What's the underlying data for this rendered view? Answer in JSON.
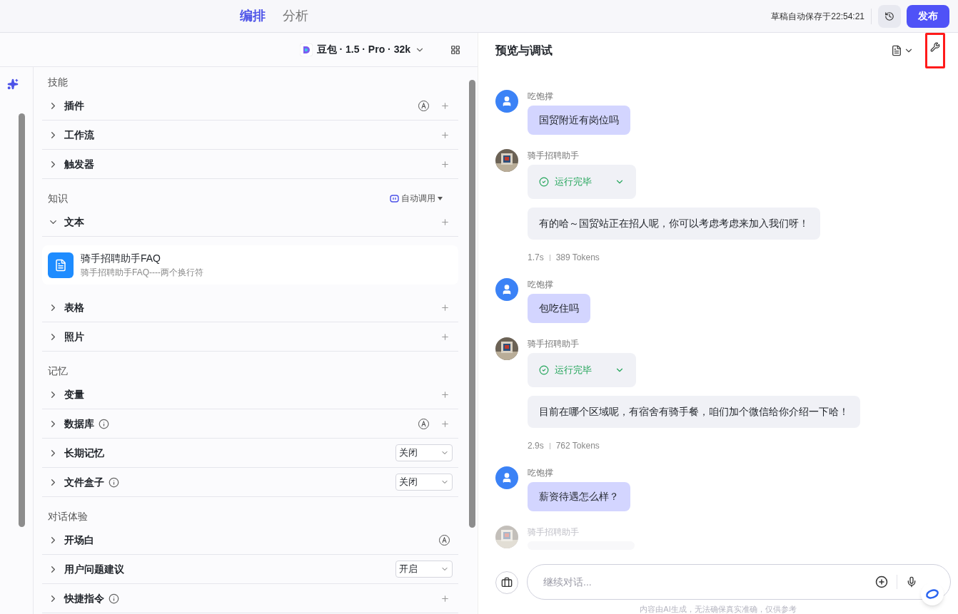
{
  "tabs": [
    {
      "label": "编排",
      "selected": true
    },
    {
      "label": "分析",
      "selected": false
    }
  ],
  "header": {
    "autosave": "草稿自动保存于22:54:21",
    "publish": "发布"
  },
  "model": {
    "name": "豆包 · 1.5 · Pro · 32k"
  },
  "sections": [
    {
      "title": "技能",
      "items": [
        {
          "label": "插件",
          "expanded": false,
          "info": false,
          "auto": true,
          "kind": "add"
        },
        {
          "label": "工作流",
          "expanded": false,
          "info": false,
          "auto": false,
          "kind": "add"
        },
        {
          "label": "触发器",
          "expanded": false,
          "info": false,
          "auto": false,
          "kind": "add"
        }
      ]
    },
    {
      "title": "知识",
      "mode": "自动调用",
      "items": [
        {
          "label": "文本",
          "expanded": true,
          "info": false,
          "auto": false,
          "kind": "add",
          "children": [
            {
              "title": "骑手招聘助手FAQ",
              "subtitle": "骑手招聘助手FAQ----两个换行符"
            }
          ]
        },
        {
          "label": "表格",
          "expanded": false,
          "info": false,
          "auto": false,
          "kind": "add"
        },
        {
          "label": "照片",
          "expanded": false,
          "info": false,
          "auto": false,
          "kind": "add"
        }
      ]
    },
    {
      "title": "记忆",
      "items": [
        {
          "label": "变量",
          "expanded": false,
          "info": false,
          "auto": false,
          "kind": "add"
        },
        {
          "label": "数据库",
          "expanded": false,
          "info": true,
          "auto": true,
          "kind": "add"
        },
        {
          "label": "长期记忆",
          "expanded": false,
          "info": false,
          "auto": false,
          "kind": "select",
          "value": "关闭"
        },
        {
          "label": "文件盒子",
          "expanded": false,
          "info": true,
          "auto": false,
          "kind": "select",
          "value": "关闭"
        }
      ]
    },
    {
      "title": "对话体验",
      "items": [
        {
          "label": "开场白",
          "expanded": false,
          "info": false,
          "auto": true,
          "kind": "plain"
        },
        {
          "label": "用户问题建议",
          "expanded": false,
          "info": false,
          "auto": false,
          "kind": "select",
          "value": "开启"
        },
        {
          "label": "快捷指令",
          "expanded": false,
          "info": true,
          "auto": false,
          "kind": "add"
        }
      ]
    }
  ],
  "preview": {
    "title": "预览与调试",
    "wrench_highlighted": true
  },
  "messages": [
    {
      "kind": "user",
      "name": "吃饱撑",
      "text": "国贸附近有岗位吗"
    },
    {
      "kind": "bot",
      "name": "骑手招聘助手",
      "status": "运行完毕",
      "text": "有的哈～国贸站正在招人呢，你可以考虑考虑来加入我们呀！",
      "time": "1.7s",
      "tokens": "389 Tokens"
    },
    {
      "kind": "user",
      "name": "吃饱撑",
      "text": "包吃住吗"
    },
    {
      "kind": "bot",
      "name": "骑手招聘助手",
      "status": "运行完毕",
      "text": "目前在哪个区域呢，有宿舍有骑手餐，咱们加个微信给你介绍一下哈！",
      "time": "2.9s",
      "tokens": "762 Tokens"
    },
    {
      "kind": "user",
      "name": "吃饱撑",
      "text": "薪资待遇怎么样？"
    },
    {
      "kind": "bot_pending",
      "name": "骑手招聘助手"
    }
  ],
  "input": {
    "placeholder": "继续对话..."
  },
  "footer": "内容由AI生成，无法确保真实准确，仅供参考"
}
